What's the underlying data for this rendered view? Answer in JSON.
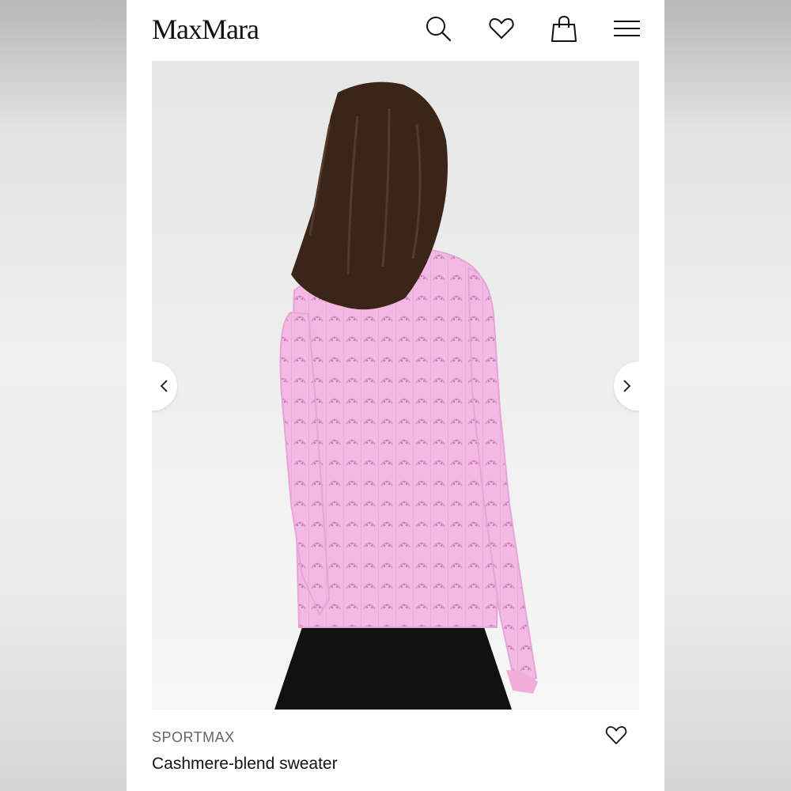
{
  "header": {
    "logo": "MaxMara",
    "icons": [
      "search-icon",
      "heart-icon",
      "shopping-bag-icon",
      "menu-icon"
    ]
  },
  "gallery": {
    "image": "model-back-view",
    "colors": {
      "sweater": "#f3b9e2",
      "hair": "#3b2519",
      "skirt": "#111111",
      "background": "#ececec"
    }
  },
  "product": {
    "brand": "SPORTMAX",
    "name": "Cashmere-blend sweater"
  }
}
